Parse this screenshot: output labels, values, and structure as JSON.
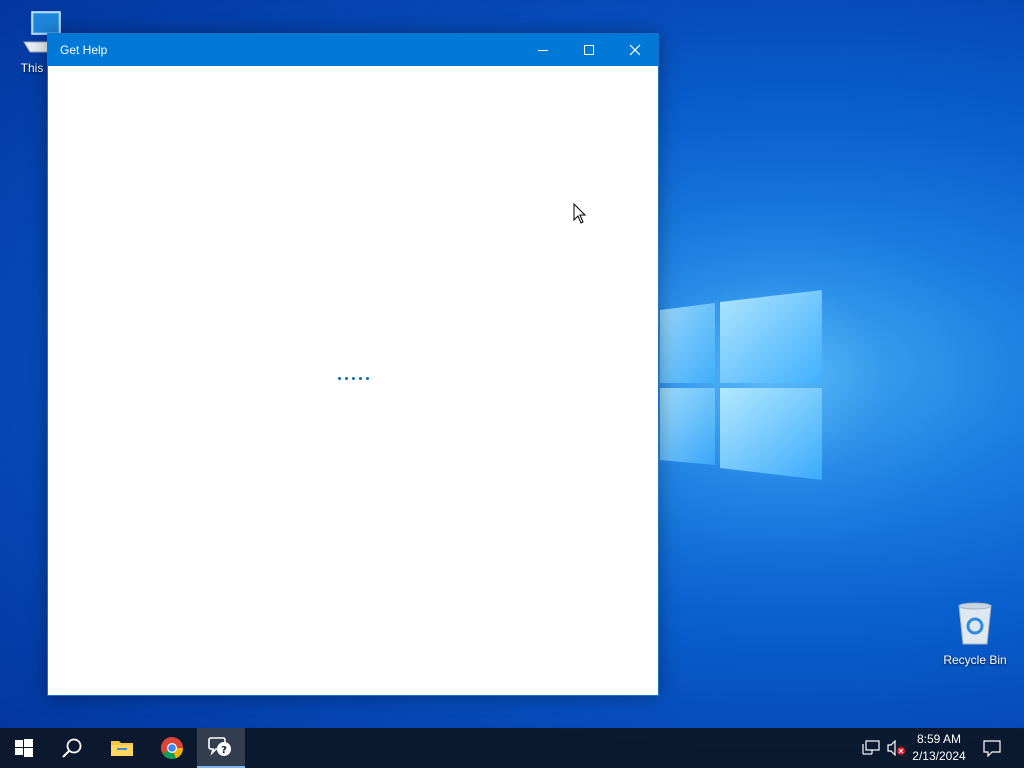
{
  "desktop": {
    "icons": [
      {
        "label": "This PC"
      },
      {
        "label": "Recycle Bin"
      }
    ]
  },
  "window": {
    "title": "Get Help",
    "controls": [
      "minimize",
      "maximize",
      "close"
    ],
    "content": {
      "state": "loading"
    }
  },
  "taskbar": {
    "items": [
      "start-icon",
      "search-icon",
      "file-explorer-icon",
      "chrome-icon",
      "get-help-icon"
    ],
    "active_item": "get-help-icon",
    "tray": {
      "icons": [
        "network-icon",
        "volume-muted-icon",
        "notifications-icon"
      ],
      "time": "8:59 AM",
      "date": "2/13/2024"
    }
  },
  "colors": {
    "titlebar": "#0078d7",
    "taskbar": "#0c1624",
    "loading_dots": "#0a6fa8"
  }
}
